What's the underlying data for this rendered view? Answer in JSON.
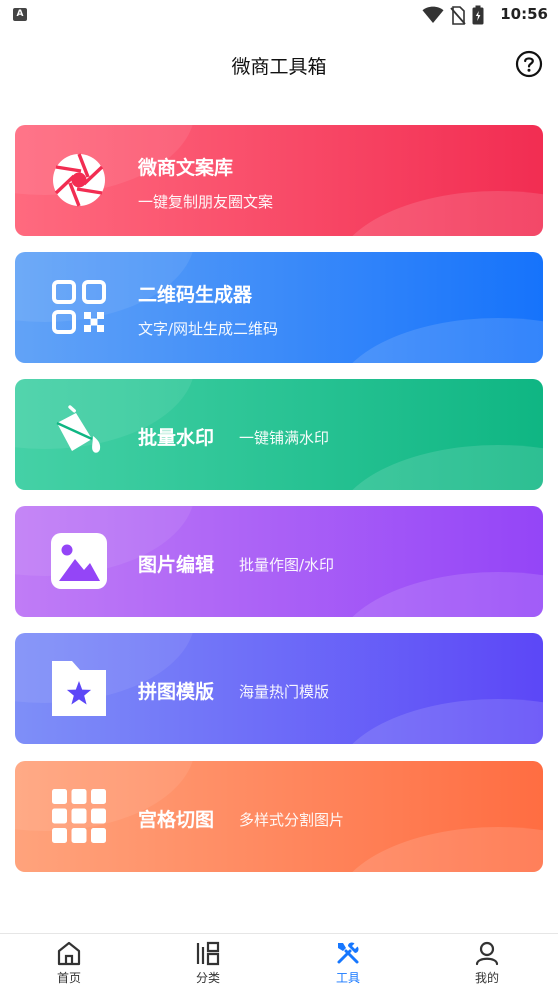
{
  "status_bar": {
    "time": "10:56",
    "left_icon": "A",
    "icons": [
      "wifi-icon",
      "no-sim-icon",
      "battery-icon"
    ]
  },
  "header": {
    "title": "微商工具箱",
    "help_icon": "question-circle-icon"
  },
  "tools": [
    {
      "title": "微商文案库",
      "subtitle": "一键复制朋友圈文案",
      "icon": "aperture-icon",
      "colors": [
        "#ff6a7f",
        "#f22d52"
      ]
    },
    {
      "title": "二维码生成器",
      "subtitle": "文字/网址生成二维码",
      "icon": "qr-code-icon",
      "colors": [
        "#62a3f7",
        "#1673fb"
      ]
    },
    {
      "title": "批量水印",
      "subtitle": "一键铺满水印",
      "icon": "paint-bucket-icon",
      "colors": [
        "#45d1a6",
        "#0fb683"
      ]
    },
    {
      "title": "图片编辑",
      "subtitle": "批量作图/水印",
      "icon": "image-icon",
      "colors": [
        "#c07cf6",
        "#9445f7"
      ]
    },
    {
      "title": "拼图模版",
      "subtitle": "海量热门模版",
      "icon": "star-folder-icon",
      "colors": [
        "#7e8ff8",
        "#5c47f7"
      ]
    },
    {
      "title": "宫格切图",
      "subtitle": "多样式分割图片",
      "icon": "grid-icon",
      "colors": [
        "#ffa37c",
        "#ff6d42"
      ]
    }
  ],
  "bottom_nav": [
    {
      "label": "首页",
      "icon": "home-icon",
      "active": false
    },
    {
      "label": "分类",
      "icon": "category-icon",
      "active": false
    },
    {
      "label": "工具",
      "icon": "tools-icon",
      "active": true
    },
    {
      "label": "我的",
      "icon": "user-icon",
      "active": false
    }
  ],
  "colors": {
    "accent": "#1677ff",
    "text": "#111111",
    "nav_text": "#333333"
  }
}
